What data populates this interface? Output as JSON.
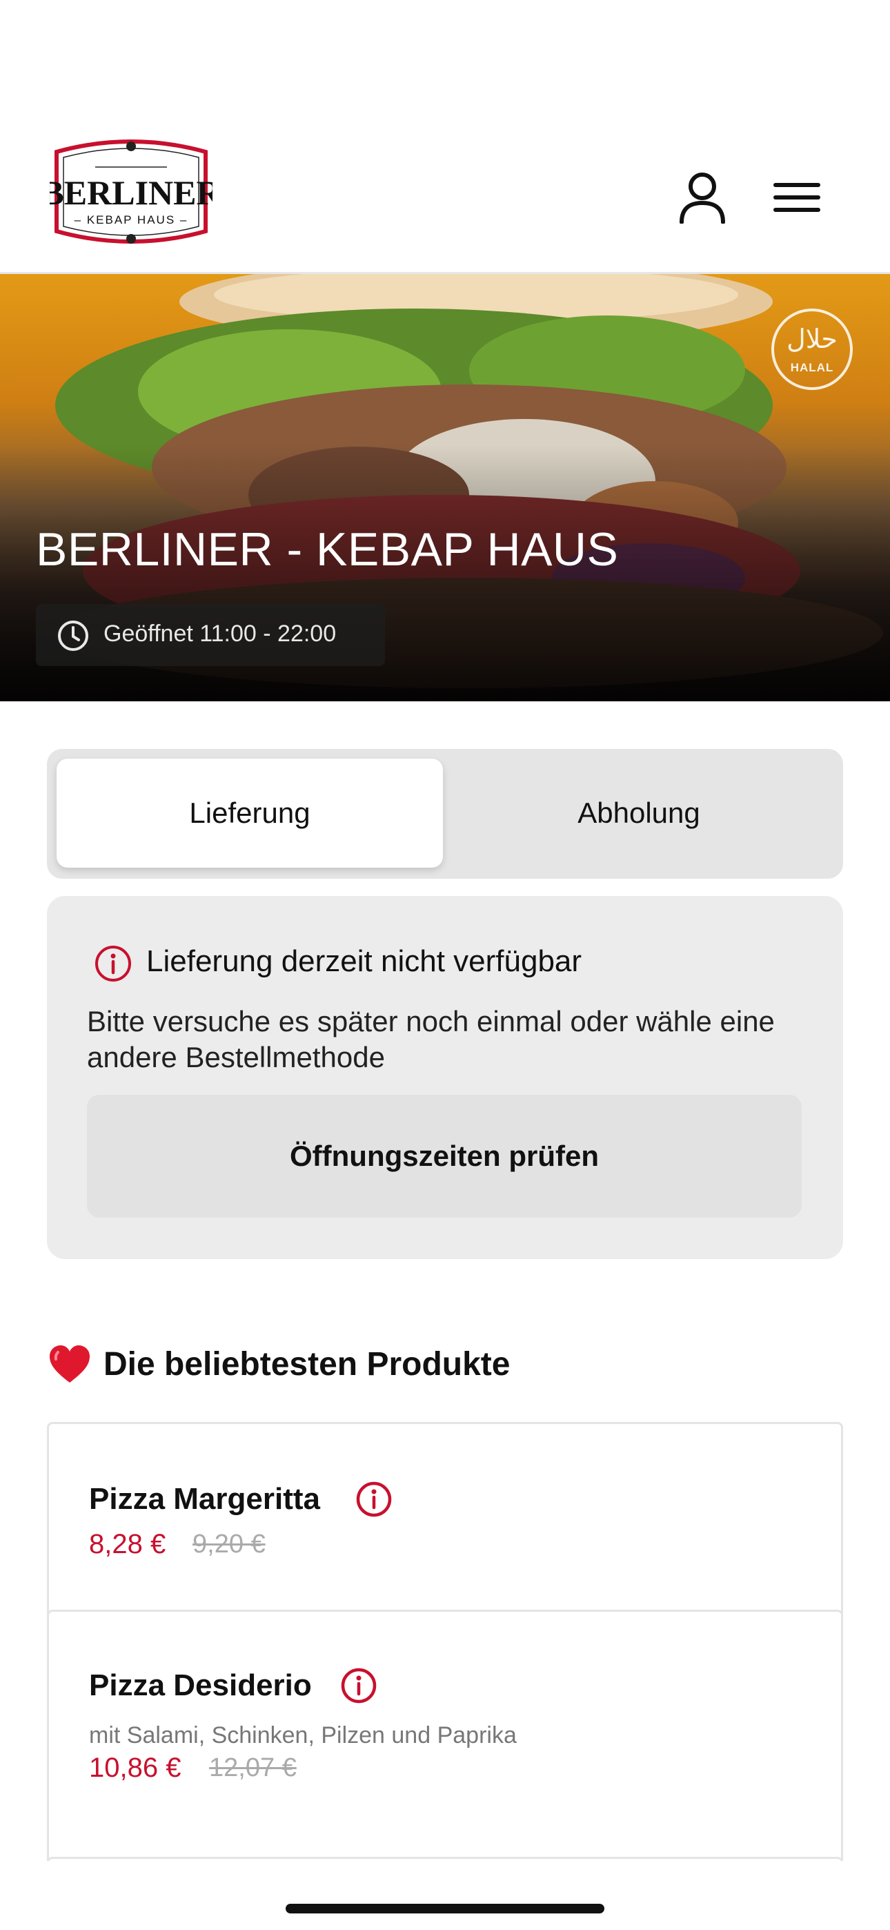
{
  "header": {
    "logo": {
      "main": "BERLINER",
      "sub": "– KEBAP HAUS –"
    },
    "account_icon": "user-icon",
    "menu_icon": "hamburger-menu-icon"
  },
  "hero": {
    "badge": {
      "arabic": "حلال",
      "latin": "HALAL"
    },
    "title": "BERLINER - KEBAP HAUS",
    "hours": "Geöffnet 11:00 - 22:00",
    "hours_icon": "clock-icon"
  },
  "order_mode": {
    "options": [
      "Lieferung",
      "Abholung"
    ],
    "selected": "Lieferung"
  },
  "notice": {
    "icon": "info-icon",
    "title": "Lieferung derzeit nicht verfügbar",
    "text": "Bitte versuche es später noch einmal oder wähle eine andere Bestellmethode",
    "button": "Öffnungszeiten prüfen"
  },
  "popular": {
    "heading_icon": "heart-icon",
    "heading": "Die beliebtesten Produkte",
    "products": [
      {
        "name": "Pizza Margeritta",
        "description": "",
        "price": "8,28 €",
        "old_price": "9,20 €"
      },
      {
        "name": "Pizza Desiderio",
        "description": "mit Salami, Schinken, Pilzen und Paprika",
        "price": "10,86 €",
        "old_price": "12,07 €"
      }
    ]
  },
  "colors": {
    "accent_red": "#c8102e",
    "card_gray": "#ececec"
  }
}
